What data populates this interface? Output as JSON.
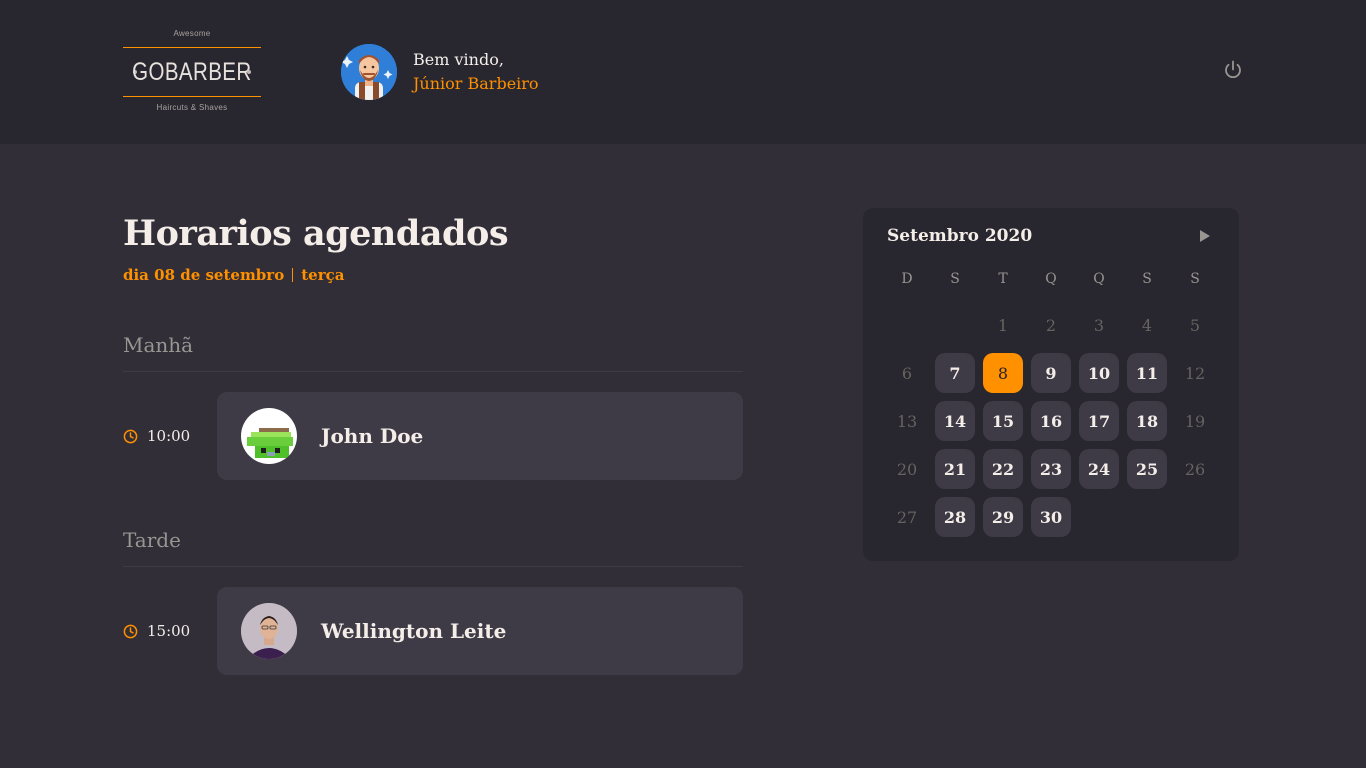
{
  "header": {
    "logo": {
      "top": "Awesome",
      "name": "GOBARBER",
      "bottom": "Haircuts & Shaves"
    },
    "welcome": "Bem vindo,",
    "user_name": "Júnior Barbeiro",
    "signout_icon": "power-icon"
  },
  "schedule": {
    "title": "Horarios agendados",
    "date_label": "dia 08 de setembro",
    "weekday_label": "terça",
    "morning": {
      "title": "Manhã",
      "appointments": [
        {
          "time": "10:00",
          "name": "John Doe"
        }
      ]
    },
    "afternoon": {
      "title": "Tarde",
      "appointments": [
        {
          "time": "15:00",
          "name": "Wellington Leite"
        }
      ]
    }
  },
  "calendar": {
    "month_label": "Setembro 2020",
    "next_icon": "play-right-icon",
    "weekdays": [
      "D",
      "S",
      "T",
      "Q",
      "Q",
      "S",
      "S"
    ],
    "first_weekday_index": 2,
    "selected_day": 8,
    "days": [
      {
        "label": "1",
        "state": "off"
      },
      {
        "label": "2",
        "state": "off"
      },
      {
        "label": "3",
        "state": "off"
      },
      {
        "label": "4",
        "state": "off"
      },
      {
        "label": "5",
        "state": "off"
      },
      {
        "label": "6",
        "state": "off"
      },
      {
        "label": "7",
        "state": "avail"
      },
      {
        "label": "8",
        "state": "sel"
      },
      {
        "label": "9",
        "state": "avail"
      },
      {
        "label": "10",
        "state": "avail"
      },
      {
        "label": "11",
        "state": "avail"
      },
      {
        "label": "12",
        "state": "off"
      },
      {
        "label": "13",
        "state": "off"
      },
      {
        "label": "14",
        "state": "avail"
      },
      {
        "label": "15",
        "state": "avail"
      },
      {
        "label": "16",
        "state": "avail"
      },
      {
        "label": "17",
        "state": "avail"
      },
      {
        "label": "18",
        "state": "avail"
      },
      {
        "label": "19",
        "state": "off"
      },
      {
        "label": "20",
        "state": "off"
      },
      {
        "label": "21",
        "state": "avail"
      },
      {
        "label": "22",
        "state": "avail"
      },
      {
        "label": "23",
        "state": "avail"
      },
      {
        "label": "24",
        "state": "avail"
      },
      {
        "label": "25",
        "state": "avail"
      },
      {
        "label": "26",
        "state": "off"
      },
      {
        "label": "27",
        "state": "off"
      },
      {
        "label": "28",
        "state": "avail"
      },
      {
        "label": "29",
        "state": "avail"
      },
      {
        "label": "30",
        "state": "avail"
      }
    ]
  },
  "colors": {
    "accent": "#ff9000",
    "background": "#312e38",
    "header": "#28262e",
    "card": "#3e3b47"
  }
}
